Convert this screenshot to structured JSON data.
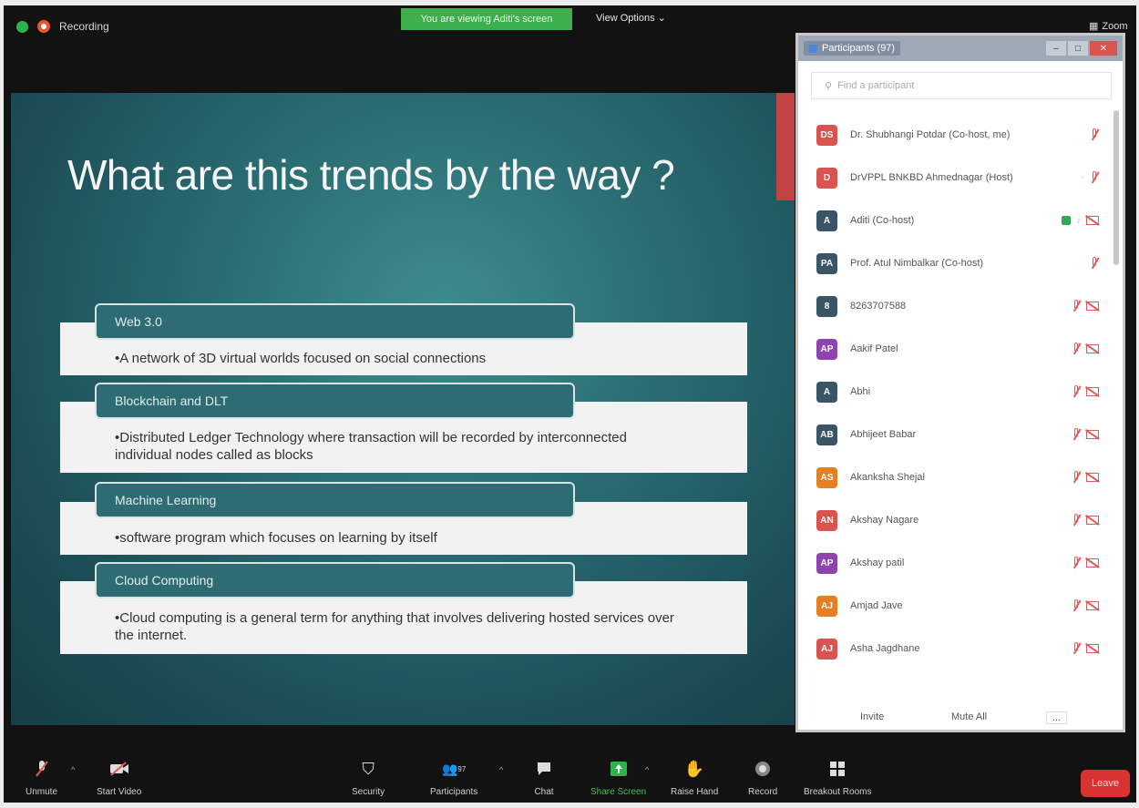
{
  "topbar": {
    "recording_label": "Recording",
    "viewing_banner": "You are viewing Aditi's screen",
    "view_options": "View Options ⌄",
    "zoom_label": "Zoom"
  },
  "slide": {
    "title": "What are this trends by the way ?",
    "trends": [
      {
        "heading": "Web 3.0",
        "body": "•A network of 3D virtual worlds focused on social connections"
      },
      {
        "heading": "Blockchain and DLT",
        "body": "•Distributed Ledger Technology where transaction will be recorded by interconnected individual nodes called as blocks"
      },
      {
        "heading": "Machine Learning",
        "body": "•software program which focuses on learning by itself"
      },
      {
        "heading": "Cloud Computing",
        "body": "•Cloud computing is a general term for anything that involves delivering hosted services over the internet."
      }
    ]
  },
  "participants_panel": {
    "title": "Participants (97)",
    "search_placeholder": "Find a participant",
    "participants": [
      {
        "initials": "DS",
        "name": "Dr. Shubhangi Potdar (Co-host, me)",
        "color": "#d9534f"
      },
      {
        "initials": "D",
        "name": "DrVPPL BNKBD Ahmednagar (Host)",
        "color": "#d9534f"
      },
      {
        "initials": "A",
        "name": "Aditi (Co-host)",
        "color": "#3a5566"
      },
      {
        "initials": "PA",
        "name": "Prof. Atul Nimbalkar (Co-host)",
        "color": "#3a5566"
      },
      {
        "initials": "8",
        "name": "8263707588",
        "color": "#3a5566"
      },
      {
        "initials": "AP",
        "name": "Aakif Patel",
        "color": "#8e44ad"
      },
      {
        "initials": "A",
        "name": "Abhi",
        "color": "#3a5566"
      },
      {
        "initials": "AB",
        "name": "Abhijeet Babar",
        "color": "#3a5566"
      },
      {
        "initials": "AS",
        "name": "Akanksha Shejal",
        "color": "#e67e22"
      },
      {
        "initials": "AN",
        "name": "Akshay Nagare",
        "color": "#d9534f"
      },
      {
        "initials": "AP",
        "name": "Akshay patil",
        "color": "#8e44ad"
      },
      {
        "initials": "AJ",
        "name": "Amjad Jave",
        "color": "#e67e22"
      },
      {
        "initials": "AJ",
        "name": "Asha Jagdhane",
        "color": "#d9534f"
      }
    ],
    "invite_label": "Invite",
    "mute_all_label": "Mute All",
    "more_label": "..."
  },
  "toolbar": {
    "unmute": "Unmute",
    "start_video": "Start Video",
    "security": "Security",
    "participants": "Participants",
    "participants_count": "97",
    "chat": "Chat",
    "share_screen": "Share Screen",
    "raise_hand": "Raise Hand",
    "record": "Record",
    "breakout_rooms": "Breakout Rooms",
    "leave": "Leave"
  }
}
